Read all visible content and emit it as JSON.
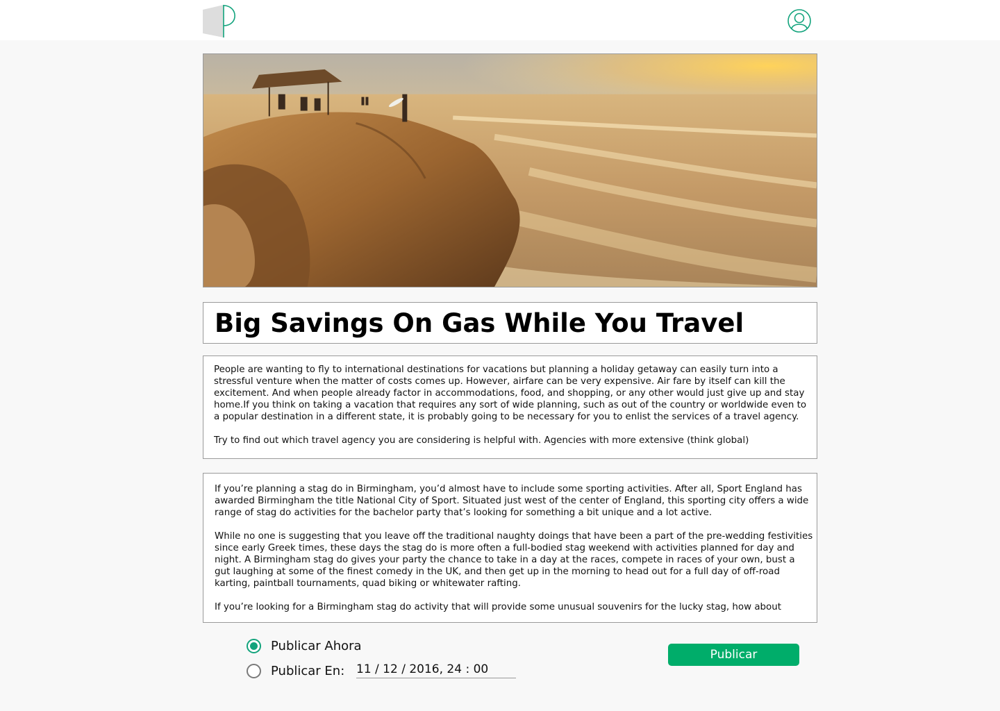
{
  "header": {
    "logo_icon": "document-p-logo-icon",
    "user_icon": "user-avatar-icon"
  },
  "post": {
    "hero_image": "coastal-cliff-sunset-photo",
    "title": "Big Savings On Gas While You Travel",
    "body_primary": [
      "People are wanting to fly to international destinations for vacations but planning a holiday getaway can easily turn into a stressful venture when the matter of costs comes up. However, airfare can be very expensive. Air fare by itself can kill the excitement. And when people already factor in accommodations, food, and shopping, or any other would just give up and stay home.If you think on taking a vacation that requires any sort of wide planning, such as out of the country or worldwide even to a popular destination in a different state, it is probably going to be necessary for you to enlist the services of a travel agency.",
      "Try to find out which travel agency you are considering is helpful with. Agencies with more extensive (think global)"
    ],
    "body_secondary": [
      "If you’re planning a stag do in Birmingham, you’d almost have to include some sporting activities. After all, Sport England has awarded Birmingham the title National City of Sport. Situated just west of the center of England, this sporting city offers a wide range of stag do activities for the bachelor party that’s looking for something a bit unique and a lot active.",
      "While no one is suggesting that you leave off the traditional naughty doings that have been a part of the pre-wedding festivities since early Greek times, these days the stag do is more often a full-bodied stag weekend with activities planned for day and night. A Birmingham stag do gives your party the chance to take in a day at the races, compete in races of your own, bust a gut laughing at some of the finest comedy in the UK, and then get up in the morning to head out for a full day of off-road karting, paintball tournaments, quad biking or whitewater rafting.",
      "If you’re looking for a Birmingham stag do activity that will provide some unusual souvenirs for the lucky stag, how about"
    ]
  },
  "publish": {
    "now_label": "Publicar Ahora",
    "at_label": "Publicar En:",
    "datetime_value": "11 / 12 / 2016, 24 : 00",
    "selected": "now",
    "button_label": "Publicar"
  },
  "colors": {
    "accent": "#12a37c",
    "button": "#00ad6a",
    "background": "#f8f8f8"
  }
}
